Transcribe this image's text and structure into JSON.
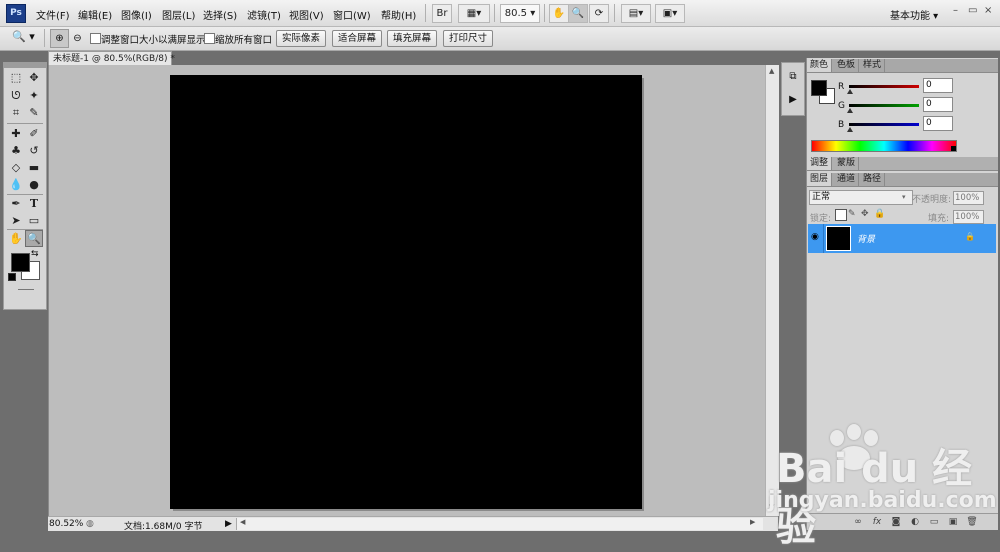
{
  "app": {
    "logo_text": "Ps",
    "menus": [
      "文件(F)",
      "编辑(E)",
      "图像(I)",
      "图层(L)",
      "选择(S)",
      "滤镜(T)",
      "视图(V)",
      "窗口(W)",
      "帮助(H)"
    ],
    "zoom_field": "80.5",
    "workspace_label": "基本功能",
    "window_controls": [
      "–",
      "▭",
      "×"
    ]
  },
  "options": {
    "checkbox1_label": "调整窗口大小以满屏显示",
    "checkbox2_label": "缩放所有窗口",
    "buttons": [
      "实际像素",
      "适合屏幕",
      "填充屏幕",
      "打印尺寸"
    ]
  },
  "document": {
    "tab_title": "未标题-1 @ 80.5%(RGB/8) *",
    "canvas_color": "#000000"
  },
  "status": {
    "zoom": "80.52%",
    "doc_info": "文档:1.68M/0 字节"
  },
  "panels": {
    "color_tabs": [
      "颜色",
      "色板",
      "样式"
    ],
    "channels": [
      {
        "label": "R",
        "value": "0",
        "color": "#cc0000"
      },
      {
        "label": "G",
        "value": "0",
        "color": "#00a000"
      },
      {
        "label": "B",
        "value": "0",
        "color": "#0000cc"
      }
    ],
    "adjust_tabs": [
      "调整",
      "蒙版"
    ],
    "layer_tabs": [
      "图层",
      "通道",
      "路径"
    ],
    "blend_mode": "正常",
    "opacity_label": "不透明度:",
    "opacity_value": "100%",
    "lock_label": "锁定:",
    "fill_label": "填充:",
    "fill_value": "100%",
    "layer": {
      "name": "背景"
    }
  },
  "watermark": {
    "logo": "Bai du 经验",
    "url": "jingyan.baidu.com"
  },
  "colors": {
    "accent_selection": "#3d98f0",
    "foreground": "#000000",
    "background": "#ffffff"
  }
}
